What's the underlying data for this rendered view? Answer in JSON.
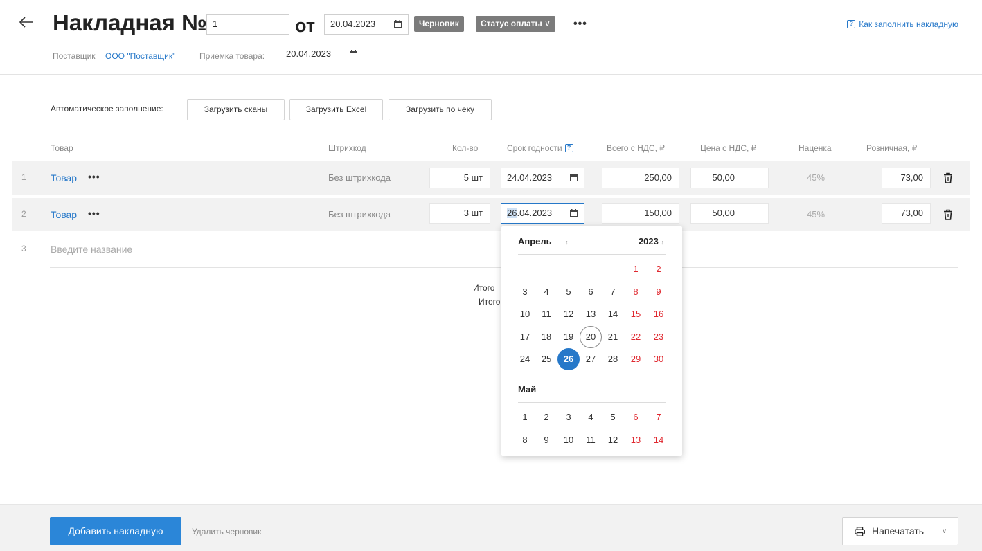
{
  "header": {
    "title": "Накладная №",
    "number": "1",
    "from_label": "от",
    "date": "20.04.2023",
    "status_badge": "Черновик",
    "payment_status": "Статус оплаты",
    "help_link": "Как заполнить накладную",
    "supplier_label": "Поставщик",
    "supplier_name": "ООО \"Поставщик\"",
    "receipt_label": "Приемка товара:",
    "receipt_date": "20.04.2023"
  },
  "autofill": {
    "label": "Автоматическое заполнение:",
    "scan_button": "Загрузить сканы",
    "excel_button": "Загрузить Excel",
    "receipt_button": "Загрузить по чеку"
  },
  "table": {
    "columns": {
      "product": "Товар",
      "barcode": "Штрихкод",
      "qty": "Кол-во",
      "expiry": "Срок годности",
      "total_vat": "Всего с НДС, ₽",
      "price_vat": "Цена с НДС, ₽",
      "markup": "Наценка",
      "retail": "Розничная, ₽"
    },
    "rows": [
      {
        "num": "1",
        "product": "Товар",
        "barcode": "Без штрихкода",
        "qty": "5 шт",
        "expiry": "24.04.2023",
        "total": "250,00",
        "price": "50,00",
        "markup": "45%",
        "retail": "73,00"
      },
      {
        "num": "2",
        "product": "Товар",
        "barcode": "Без штрихкода",
        "qty": "3 шт",
        "expiry_sel": "26",
        "expiry_rest": ".04.2023",
        "total": "150,00",
        "price": "50,00",
        "markup": "45%",
        "retail": "73,00"
      }
    ],
    "new_row": {
      "num": "3",
      "placeholder": "Введите название"
    },
    "totals": {
      "line1": "Итого",
      "line2": "Итого"
    }
  },
  "calendar": {
    "month1": "Апрель",
    "year": "2023",
    "month2": "Май",
    "april_days": [
      "1",
      "2",
      "3",
      "4",
      "5",
      "6",
      "7",
      "8",
      "9",
      "10",
      "11",
      "12",
      "13",
      "14",
      "15",
      "16",
      "17",
      "18",
      "19",
      "20",
      "21",
      "22",
      "23",
      "24",
      "25",
      "26",
      "27",
      "28",
      "29",
      "30"
    ],
    "may_days": [
      "1",
      "2",
      "3",
      "4",
      "5",
      "6",
      "7",
      "8",
      "9",
      "10",
      "11",
      "12",
      "13",
      "14"
    ],
    "today": "20",
    "selected": "26"
  },
  "footer": {
    "add_button": "Добавить накладную",
    "delete_draft": "Удалить черновик",
    "print_button": "Напечатать"
  },
  "colors": {
    "accent": "#2678c9",
    "primary_button": "#2b86d8",
    "weekend": "#e0282f",
    "badge": "#7b7b7b"
  }
}
